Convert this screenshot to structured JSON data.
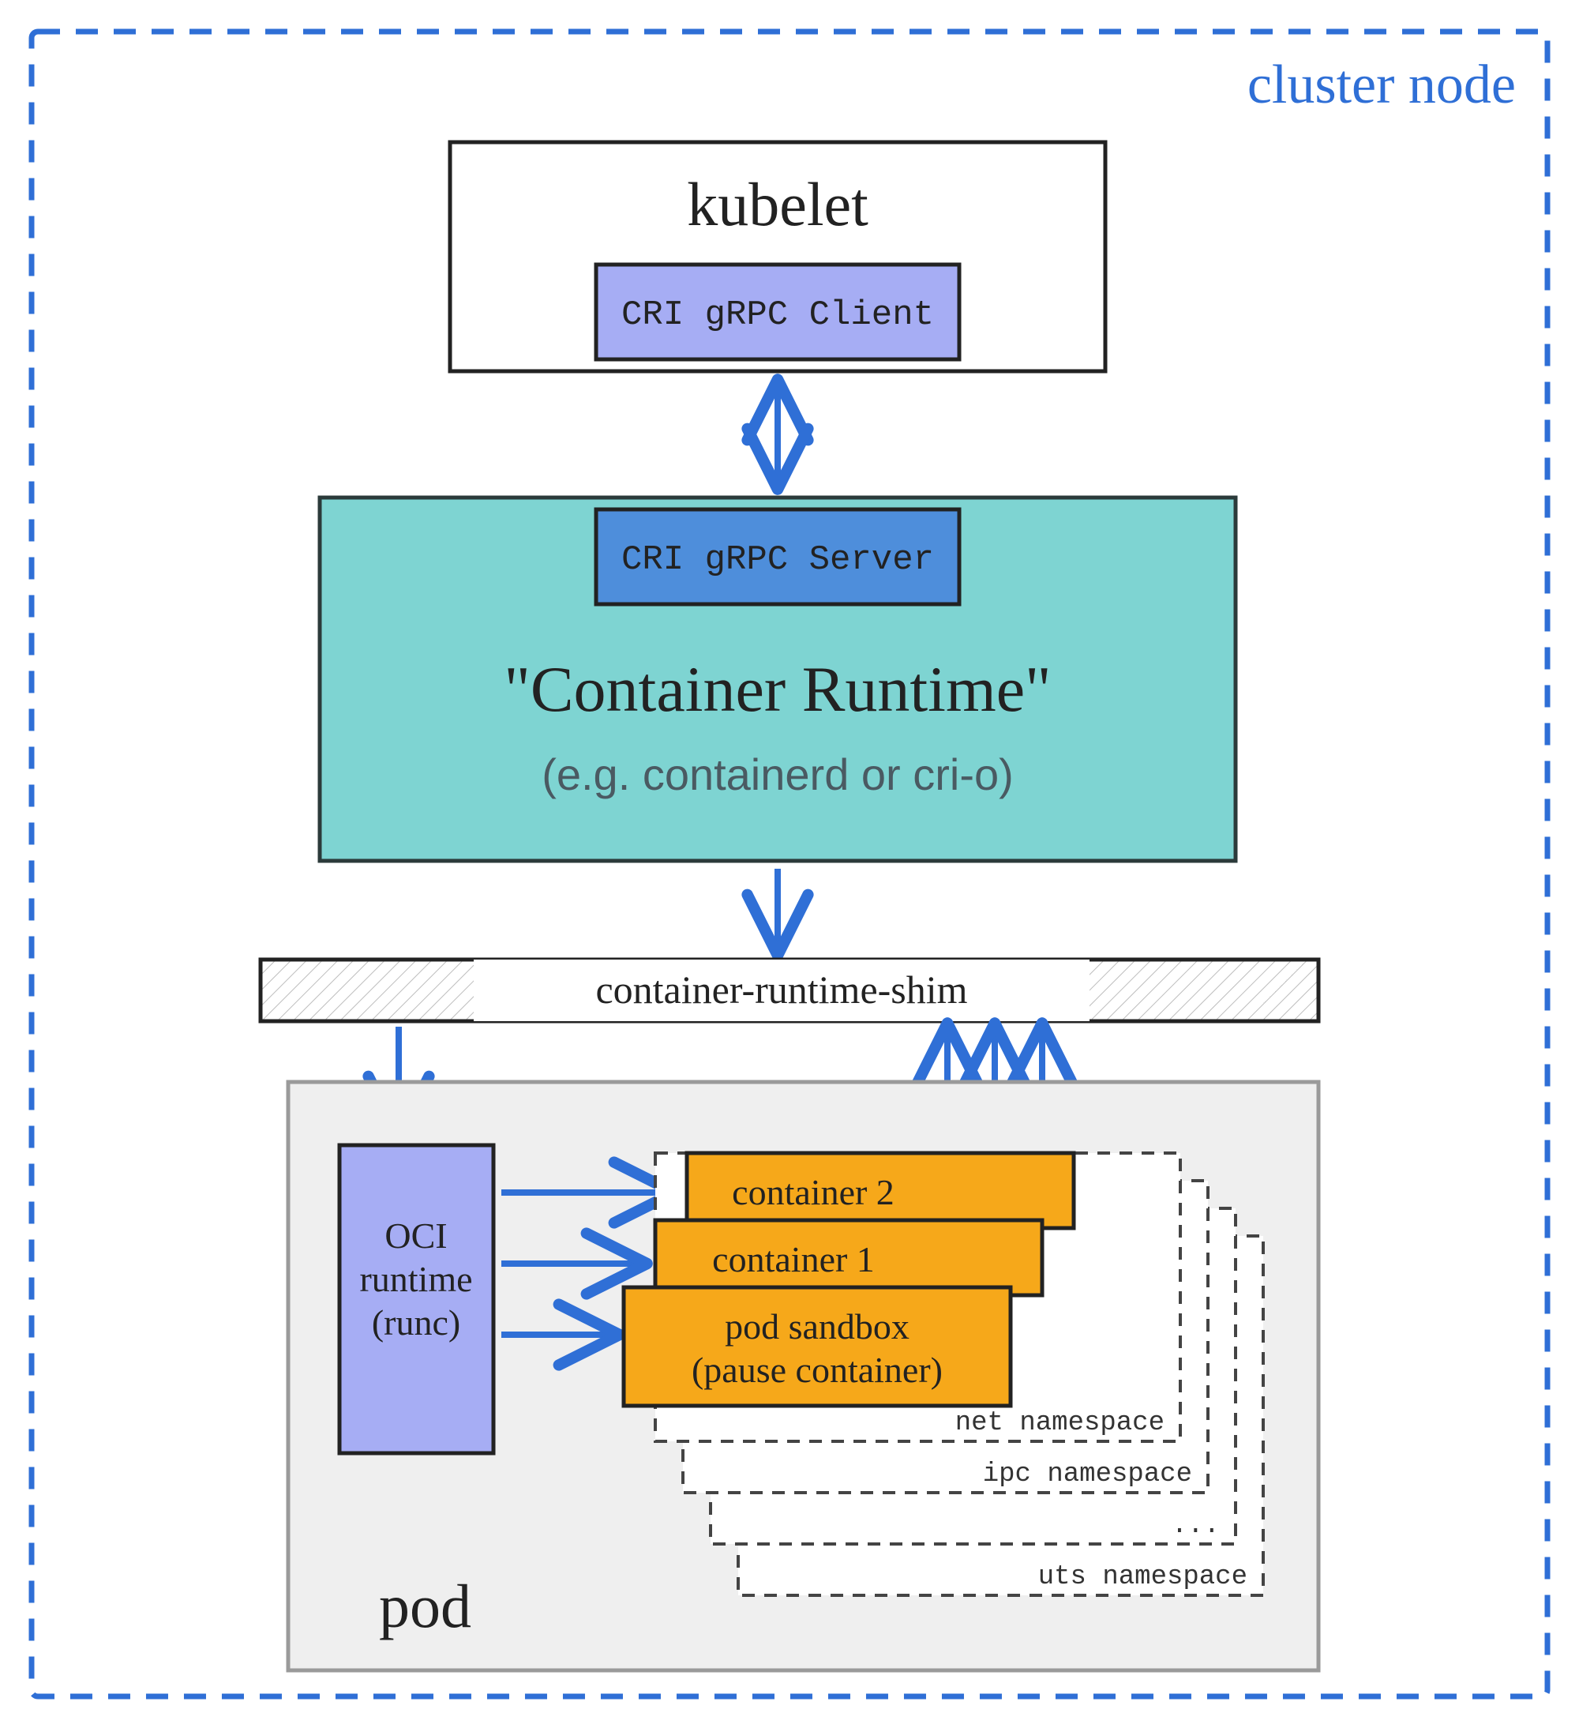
{
  "cluster_node_label": "cluster node",
  "kubelet": {
    "title": "kubelet",
    "client_label": "CRI gRPC Client"
  },
  "runtime": {
    "server_label": "CRI gRPC Server",
    "title": "\"Container Runtime\"",
    "subtitle": "(e.g. containerd or cri-o)"
  },
  "shim_label": "container-runtime-shim",
  "pod": {
    "label": "pod",
    "oci_line1": "OCI",
    "oci_line2": "runtime",
    "oci_line3": "(runc)",
    "container2": "container 2",
    "container1": "container 1",
    "sandbox_line1": "pod sandbox",
    "sandbox_line2": "(pause container)",
    "ns_net": "net namespace",
    "ns_ipc": "ipc namespace",
    "ns_dots": "...",
    "ns_uts": "uts namespace"
  },
  "colors": {
    "border_dash_blue": "#2f6fd6",
    "teal_fill": "#7ed4d2",
    "teal_stroke": "#2b3a3a",
    "pale_blue_fill": "#a6adf4",
    "deep_blue_fill": "#4e8edb",
    "orange_fill": "#f6a81a",
    "pod_grey": "#efefef",
    "grey_stroke": "#9a9a9a",
    "text_dark": "#222222",
    "text_sub": "#4a5a62"
  }
}
